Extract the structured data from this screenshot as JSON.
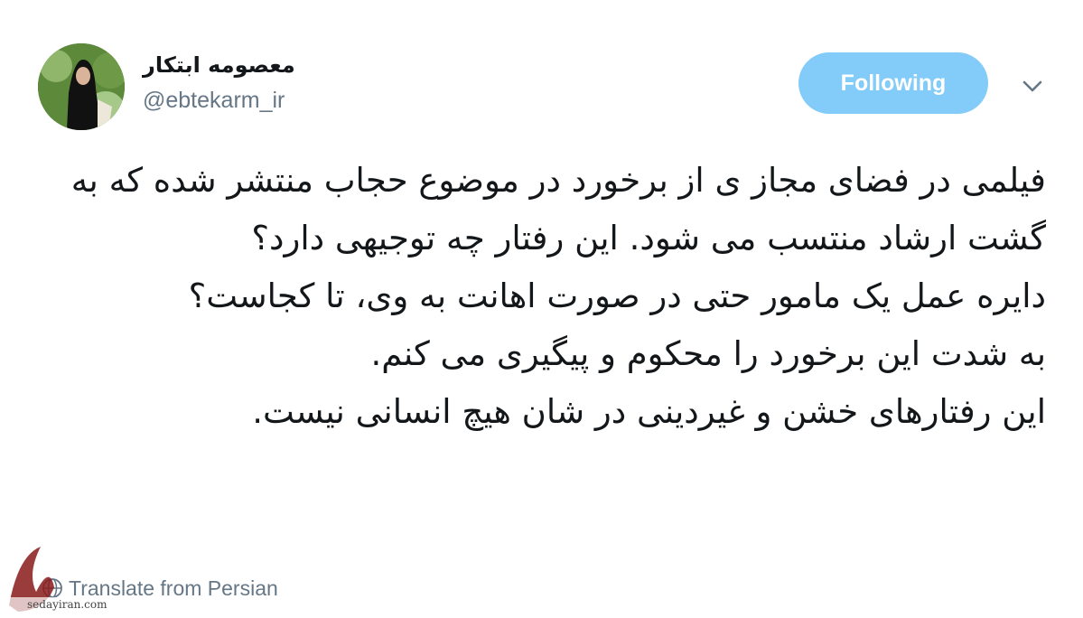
{
  "profile": {
    "display_name": "معصومه ابتکار",
    "handle": "@ebtekarm_ir"
  },
  "follow": {
    "label": "Following"
  },
  "tweet": {
    "paragraphs": [
      "فیلمی در فضای مجاز ی از برخورد در موضوع حجاب منتشر شده که به گشت ارشاد منتسب می شود. این رفتار چه توجیهی دارد؟",
      "دایره عمل یک مامور حتی در صورت اهانت به وی، تا کجاست؟",
      "به شدت این برخورد را محکوم و پیگیری می کنم.",
      "این رفتارهای خشن و غیردینی در شان هیچ انسانی نیست."
    ]
  },
  "translate": {
    "label": "Translate from Persian"
  },
  "watermark": {
    "site": "sedayiran.com"
  },
  "colors": {
    "accent": "#1da1f2",
    "text": "#14171a",
    "muted": "#657786"
  },
  "icons": {
    "dropdown": "chevron-down-icon",
    "translate": "globe-icon"
  }
}
